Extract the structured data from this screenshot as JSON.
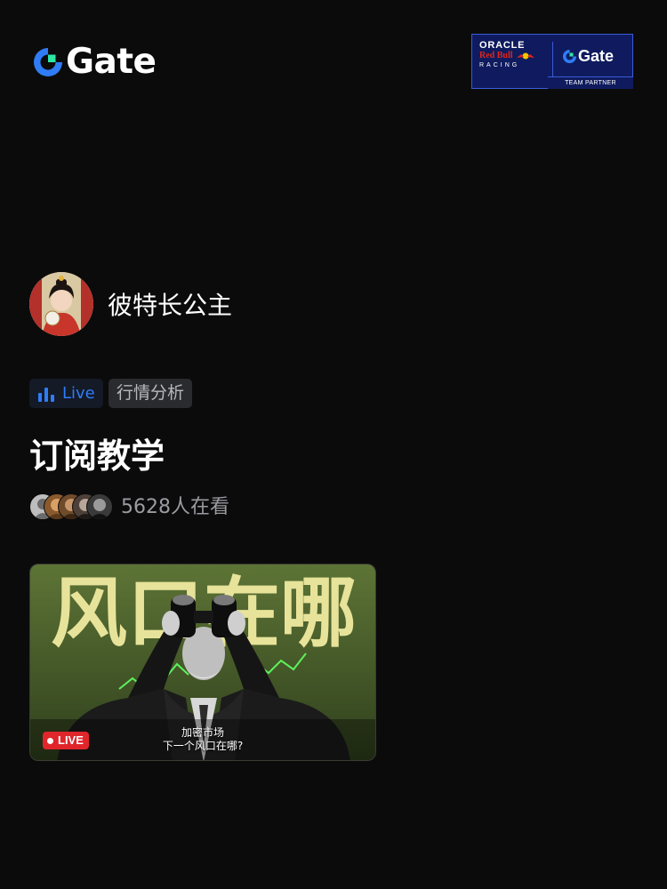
{
  "header": {
    "logo_text": "Gate",
    "partner": {
      "oracle": "ORACLE",
      "redbull": "Red Bull",
      "racing": "RACING",
      "gate": "Gate",
      "tag": "TEAM PARTNER"
    }
  },
  "streamer": {
    "name": "彼特长公主"
  },
  "tags": {
    "live_label": "Live",
    "category": "行情分析"
  },
  "stream": {
    "title": "订阅教学",
    "viewers_text": "5628人在看",
    "thumbnail": {
      "headline": "风口在哪",
      "badge": "LIVE",
      "subtitle_line1": "加密市场",
      "subtitle_line2": "下一个风口在哪?"
    }
  },
  "colors": {
    "background": "#0b0b0c",
    "accent_blue": "#2f7cf6",
    "live_red": "#e0262b",
    "partner_navy": "#0f1b5e"
  },
  "icons": {
    "logo": "gate-logo-icon",
    "live_tag": "bar-chart-icon"
  }
}
